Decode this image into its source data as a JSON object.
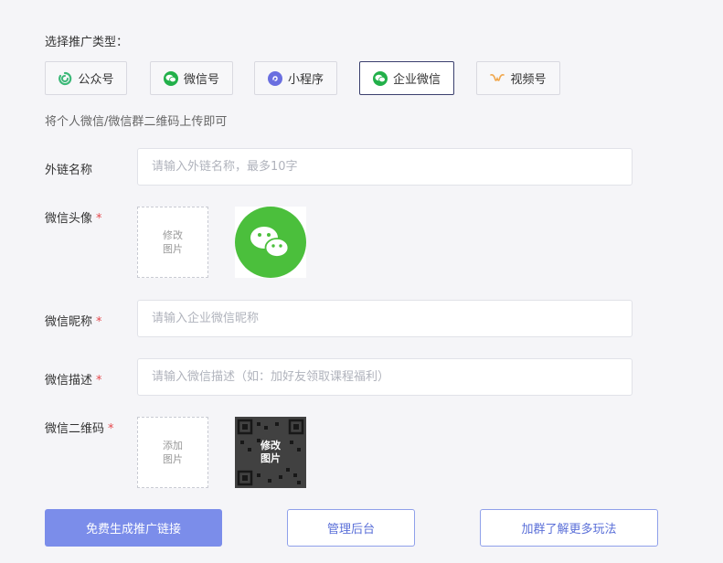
{
  "promo": {
    "label": "选择推广类型：",
    "types": [
      {
        "label": "公众号"
      },
      {
        "label": "微信号"
      },
      {
        "label": "小程序"
      },
      {
        "label": "企业微信"
      },
      {
        "label": "视频号"
      }
    ],
    "active_index": 3,
    "hint": "将个人微信/微信群二维码上传即可"
  },
  "form": {
    "link_name": {
      "label": "外链名称",
      "placeholder": "请输入外链名称，最多10字"
    },
    "avatar": {
      "label": "微信头像",
      "required": "*",
      "upload_line1": "修改",
      "upload_line2": "图片"
    },
    "nickname": {
      "label": "微信昵称",
      "required": "*",
      "placeholder": "请输入企业微信昵称"
    },
    "description": {
      "label": "微信描述",
      "required": "*",
      "placeholder": "请输入微信描述（如：加好友领取课程福利）"
    },
    "qrcode": {
      "label": "微信二维码",
      "required": "*",
      "upload_line1": "添加",
      "upload_line2": "图片",
      "overlay_line1": "修改",
      "overlay_line2": "图片"
    }
  },
  "actions": {
    "generate": "免费生成推广链接",
    "admin": "管理后台",
    "join_group": "加群了解更多玩法"
  },
  "colors": {
    "accent": "#7b8dea",
    "wechat_green": "#4bbf3c",
    "required": "#e5484d"
  },
  "icons": {
    "official_account": "official-account-icon",
    "wechat": "wechat-icon",
    "miniprogram": "miniprogram-icon",
    "work_wechat": "work-wechat-icon",
    "channels": "channels-icon"
  }
}
